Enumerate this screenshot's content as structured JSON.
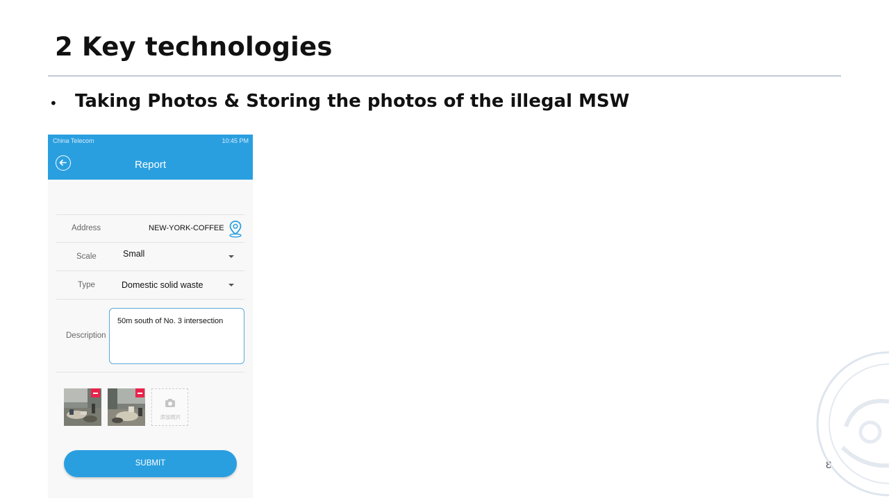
{
  "slide": {
    "title": "2 Key technologies",
    "bullet_symbol": "•",
    "bullet": "Taking Photos & Storing the photos of the illegal MSW",
    "page_number": "8"
  },
  "phone": {
    "status_bar": {
      "carrier": "China Telecom",
      "time": "10:45 PM"
    },
    "app_bar": {
      "title": "Report",
      "back_icon": "arrow-left-circle-icon"
    },
    "form": {
      "address": {
        "label": "Address",
        "value": "NEW-YORK-COFFEE",
        "icon": "location-pin-icon"
      },
      "scale": {
        "label": "Scale",
        "value": "Small"
      },
      "type": {
        "label": "Type",
        "value": "Domestic solid waste"
      },
      "description": {
        "label": "Description",
        "value": "50m south of No. 3 intersection"
      }
    },
    "photos": {
      "count": 2,
      "add_label": "添加照片"
    },
    "submit_label": "SUBMIT"
  },
  "colors": {
    "accent": "#2a9fe0",
    "remove_badge": "#e8234a",
    "rule": "#8c9bb0"
  }
}
